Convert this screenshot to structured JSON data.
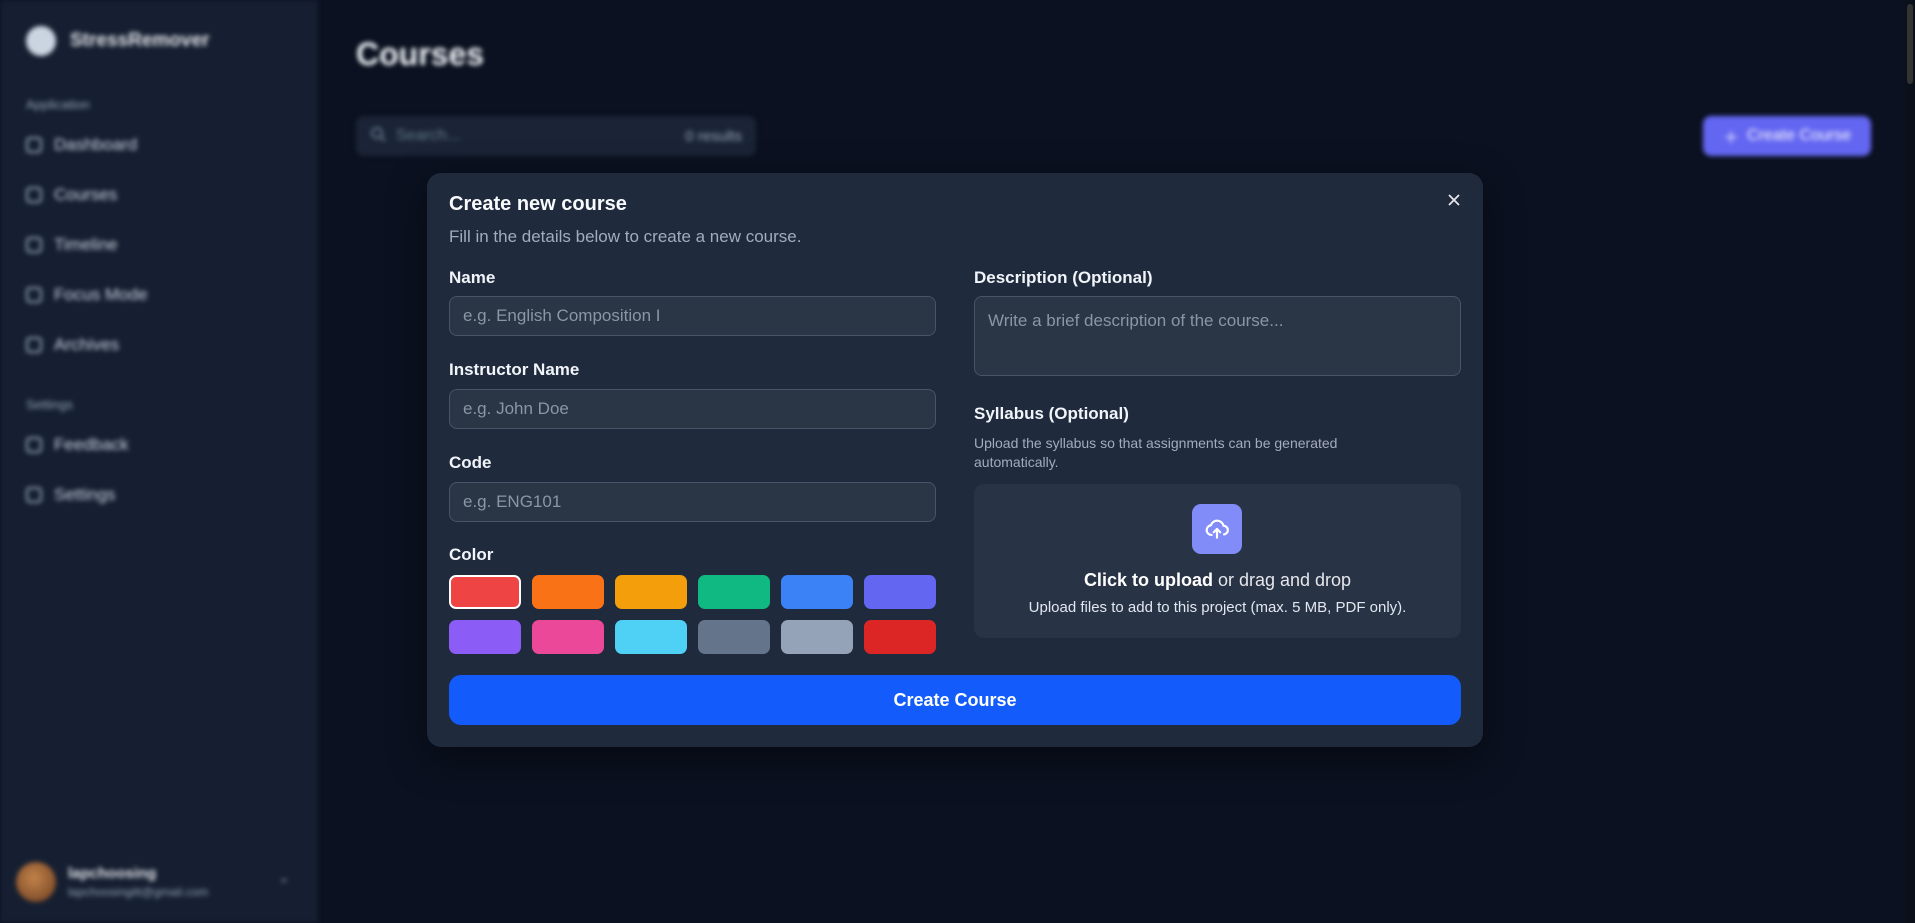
{
  "background": {
    "brand_name": "StressRemover",
    "sections": {
      "application": "Application",
      "settings": "Settings"
    },
    "nav": [
      "Dashboard",
      "Courses",
      "Timeline",
      "Focus Mode",
      "Archives"
    ],
    "settings_nav": [
      "Feedback",
      "Settings"
    ],
    "user": {
      "name": "lapchoosing",
      "email": "lapchoosingitt@gmail.com"
    },
    "page_title": "Courses",
    "search": {
      "placeholder": "Search...",
      "count": "0 results"
    },
    "create_button": "Create Course"
  },
  "modal": {
    "title": "Create new course",
    "subtitle": "Fill in the details below to create a new course.",
    "name": {
      "label": "Name",
      "placeholder": "e.g. English Composition I"
    },
    "instructor": {
      "label": "Instructor Name",
      "placeholder": "e.g. John Doe"
    },
    "code": {
      "label": "Code",
      "placeholder": "e.g. ENG101"
    },
    "color": {
      "label": "Color",
      "selected": "#ef4444",
      "swatches": [
        "#ef4444",
        "#f97316",
        "#f59e0b",
        "#10b981",
        "#3b82f6",
        "#6366f1",
        "#8b5cf6",
        "#ec4899",
        "#4fd1f5",
        "#64748b",
        "#94a3b8",
        "#dc2626"
      ]
    },
    "description": {
      "label": "Description (Optional)",
      "placeholder": "Write a brief description of the course..."
    },
    "syllabus": {
      "label": "Syllabus (Optional)",
      "help": "Upload the syllabus so that assignments can be generated automatically.",
      "upload_strong": "Click to upload",
      "upload_rest": " or drag and drop",
      "upload_sub": "Upload files to add to this project (max. 5 MB, PDF only)."
    },
    "submit_label": "Create Course",
    "accent_color": "#135cfb"
  }
}
